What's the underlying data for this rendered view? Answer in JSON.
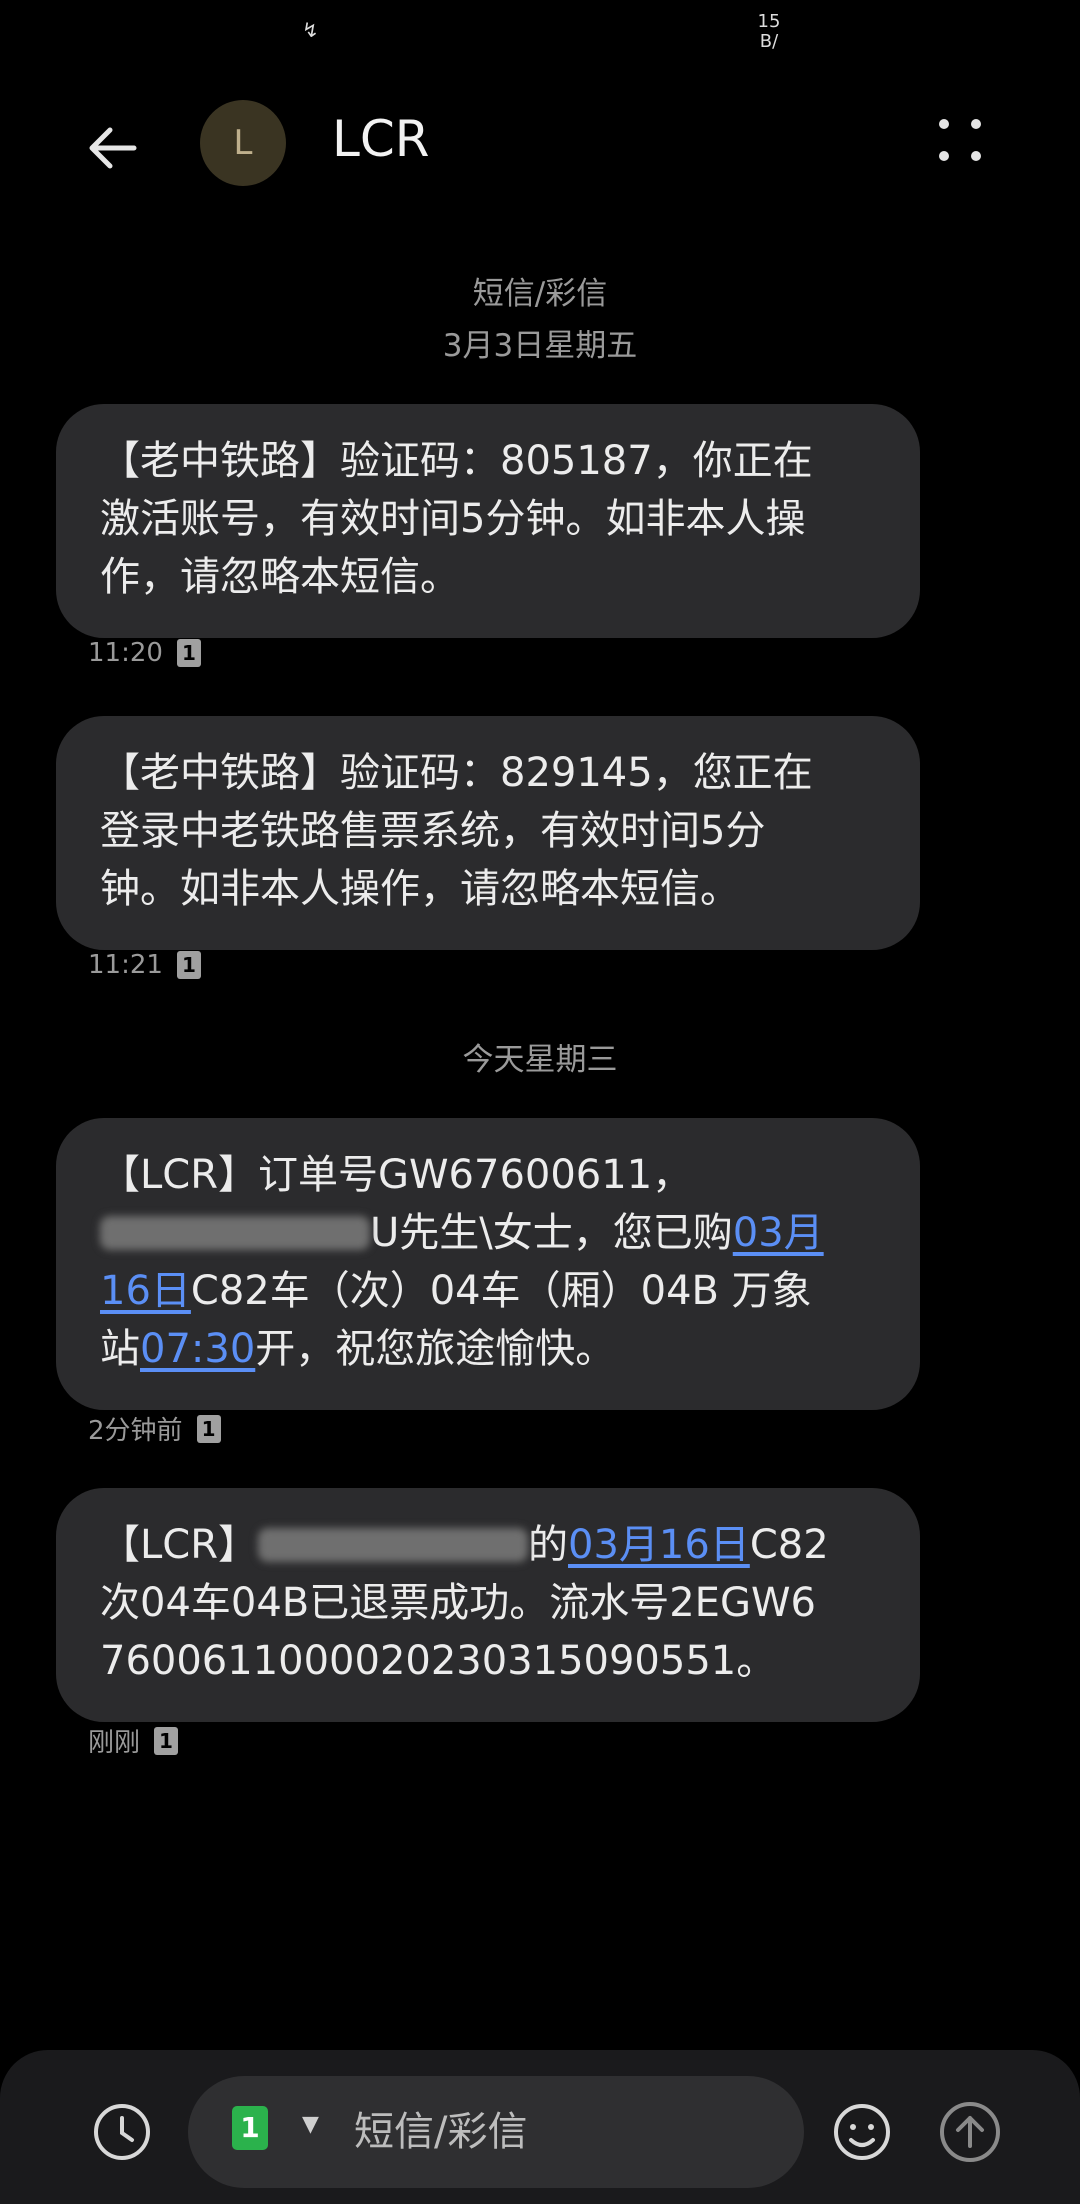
{
  "status_bar": {
    "speed_top": "15",
    "speed_bottom": "B/"
  },
  "header": {
    "avatar_letter": "L",
    "contact_name": "LCR"
  },
  "date_headers": [
    "短信/彩信",
    "3月3日星期五",
    "今天星期三"
  ],
  "messages": [
    {
      "lines": [
        "【老中铁路】验证码：805187，你正在",
        "激活账号，有效时间5分钟。如非本人操",
        "作，请忽略本短信。"
      ],
      "time": "11:20",
      "sim": "1"
    },
    {
      "lines": [
        "【老中铁路】验证码：829145，您正在",
        "登录中老铁路售票系统，有效时间5分",
        "钟。如非本人操作，请忽略本短信。"
      ],
      "time": "11:21",
      "sim": "1"
    },
    {
      "parts": {
        "l1": "【LCR】订单号GW67600611，",
        "l2_text": "U先生\\女士，您已购",
        "l2_link": "03月",
        "l3_link": "16日",
        "l3_text": "C82车（次）04车（厢）04B 万象",
        "l4_text_a": "站",
        "l4_link": "07:30",
        "l4_text_b": "开，祝您旅途愉快。"
      },
      "time": "2分钟前",
      "sim": "1"
    },
    {
      "parts": {
        "l1_prefix": "【LCR】",
        "l1_mid": "的",
        "l1_link": "03月16日",
        "l1_suffix": "C82",
        "l2": "次04车04B已退票成功。流水号2EGW6",
        "l3": "76006110000202303150905​51。"
      },
      "time": "刚刚",
      "sim": "1"
    }
  ],
  "composer": {
    "sim": "1",
    "placeholder": "短信/彩信"
  },
  "icons": [
    "back-arrow-icon",
    "more-dots-icon",
    "schedule-clock-icon",
    "emoji-icon",
    "send-icon"
  ]
}
